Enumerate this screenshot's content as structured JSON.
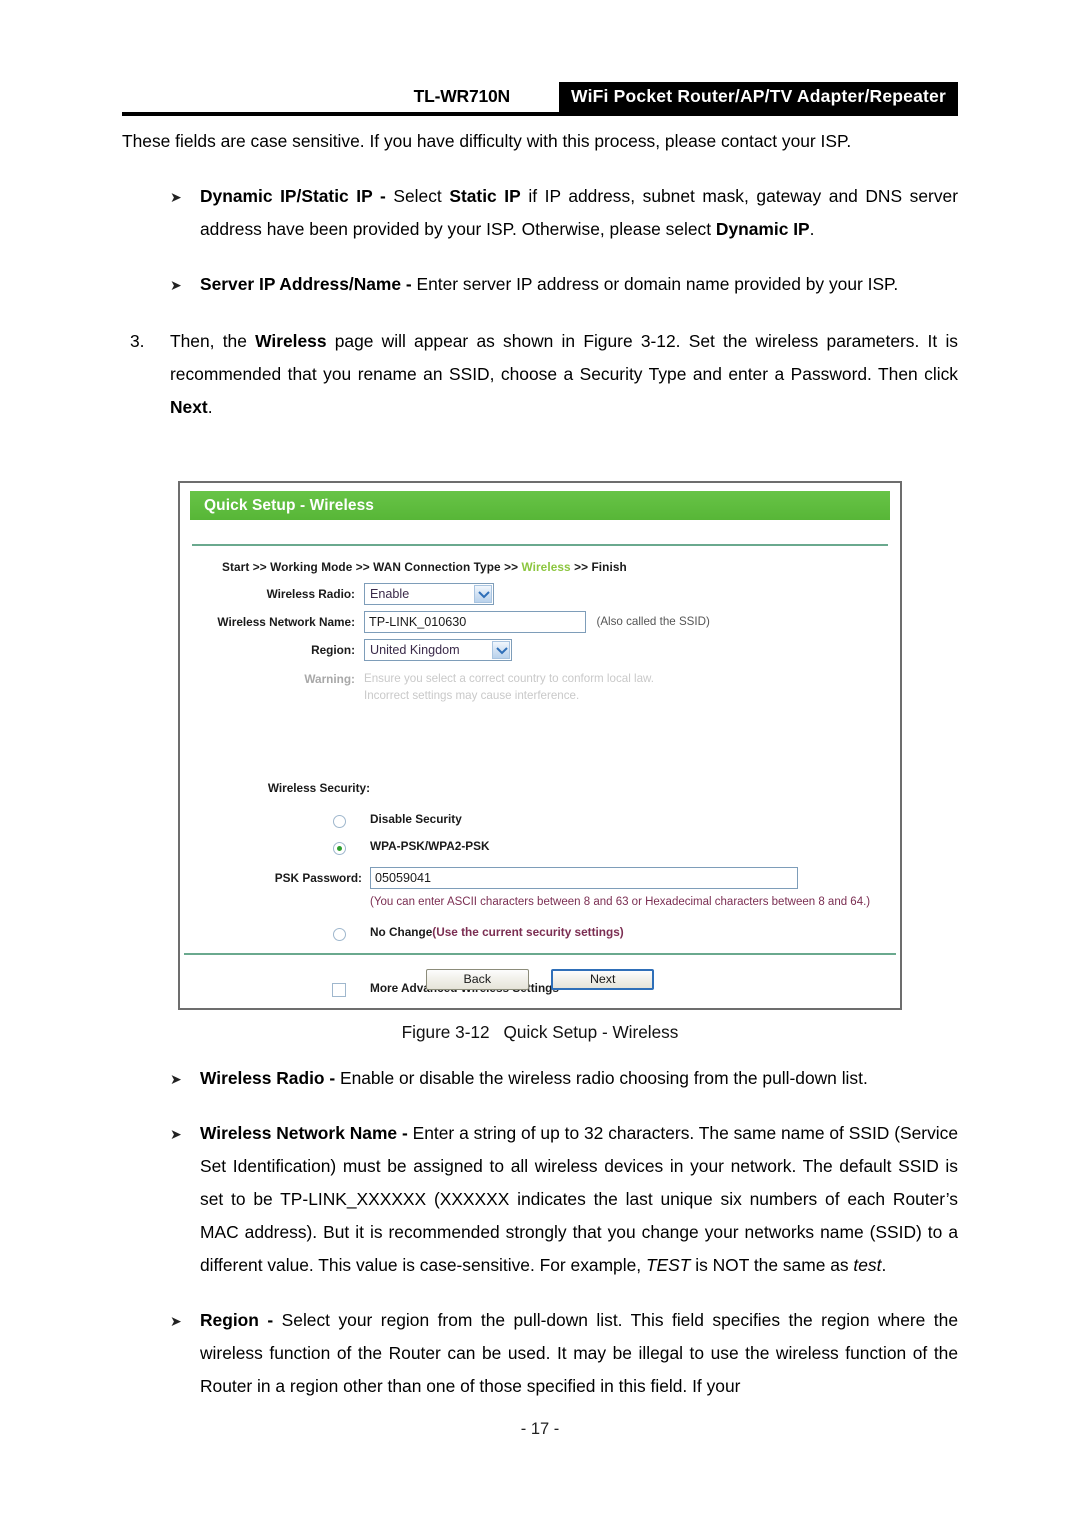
{
  "header": {
    "model": "TL-WR710N",
    "banner": "WiFi Pocket Router/AP/TV Adapter/Repeater"
  },
  "intro": {
    "text_1": "These fields are case sensitive. If you have difficulty with this process, please contact your ISP."
  },
  "bullets_top": [
    {
      "marker": "➤",
      "term": "Dynamic IP/Static IP - ",
      "body_1": "Select ",
      "emph_1": "Static IP",
      "body_2": " if IP address, subnet mask, gateway and DNS server address have been provided by your ISP. Otherwise, please select ",
      "emph_2": "Dynamic IP",
      "body_3": "."
    },
    {
      "marker": "➤",
      "term": "Server IP Address/Name - ",
      "body_1": "Enter server IP address or domain name provided by your ISP.",
      "emph_1": "",
      "body_2": "",
      "emph_2": "",
      "body_3": ""
    }
  ],
  "step": {
    "number": "3.",
    "part_1": "Then, the ",
    "emph_1": "Wireless",
    "part_2": " page will appear as shown in Figure 3-12. Set the wireless parameters. It is recommended that you rename an SSID, choose a Security Type and enter a Password. Then click ",
    "emph_2": "Next",
    "part_3": "."
  },
  "router_ui": {
    "title": "Quick Setup - Wireless",
    "breadcrumb": {
      "step_1": "Start",
      "step_2": "Working Mode",
      "step_3": "WAN Connection Type",
      "step_4": "Wireless",
      "step_5": "Finish",
      "separator": ">>",
      "active_color": "#8cc63f"
    },
    "fields": {
      "wireless_radio_label": "Wireless Radio:",
      "wireless_radio_value": "Enable",
      "network_name_label": "Wireless Network Name:",
      "network_name_value": "TP-LINK_010630",
      "network_name_hint": "(Also called the SSID)",
      "region_label": "Region:",
      "region_value": "United Kingdom",
      "warning_label": "Warning:",
      "warning_line_1": "Ensure you select a correct country to conform local law.",
      "warning_line_2": "Incorrect settings may cause interference."
    },
    "security": {
      "section_label": "Wireless Security:",
      "option_disable": "Disable Security",
      "option_wpa": "WPA-PSK/WPA2-PSK",
      "psk_label": "PSK Password:",
      "psk_value": "05059041",
      "psk_note": "(You can enter ASCII characters between 8 and 63 or Hexadecimal characters between 8 and 64.)",
      "option_nochange_bold": "No Change",
      "option_nochange_rest": "(Use the current security settings)",
      "checkbox_advanced": "More Advanced Wireless Settings"
    },
    "buttons": {
      "back": "Back",
      "next": "Next"
    },
    "colors": {
      "title_bar": "#5cbc3d",
      "divider": "#6aa98e",
      "radio_dot": "#2d9e2d",
      "note_text": "#7b2e52"
    }
  },
  "figure": {
    "number": "Figure 3-12",
    "caption": "Quick Setup - Wireless"
  },
  "bullets_bottom": [
    {
      "marker": "➤",
      "term": "Wireless Radio - ",
      "body": "Enable or disable the wireless radio choosing from the pull-down list."
    },
    {
      "marker": "➤",
      "term": "Wireless Network Name - ",
      "body_1": "Enter a string of up to 32 characters. The same name of SSID (Service Set Identification) must be assigned to all wireless devices in your network. The default SSID is set to be TP-LINK_XXXXXX (XXXXXX indicates the last unique six numbers of each Router’s MAC address). But it is recommended strongly that you change your networks name (SSID) to a different value. This value is case-sensitive. For example, ",
      "italic_1": "TEST",
      "body_2": " is NOT the same as ",
      "italic_2": "test",
      "body_3": "."
    },
    {
      "marker": "➤",
      "term": "Region - ",
      "body": "Select your region from the pull-down list. This field specifies the region where the wireless function of the Router can be used. It may be illegal to use the wireless function of the Router in a region other than one of those specified in this field. If your"
    }
  ],
  "footer": {
    "page_number": "- 17 -"
  }
}
